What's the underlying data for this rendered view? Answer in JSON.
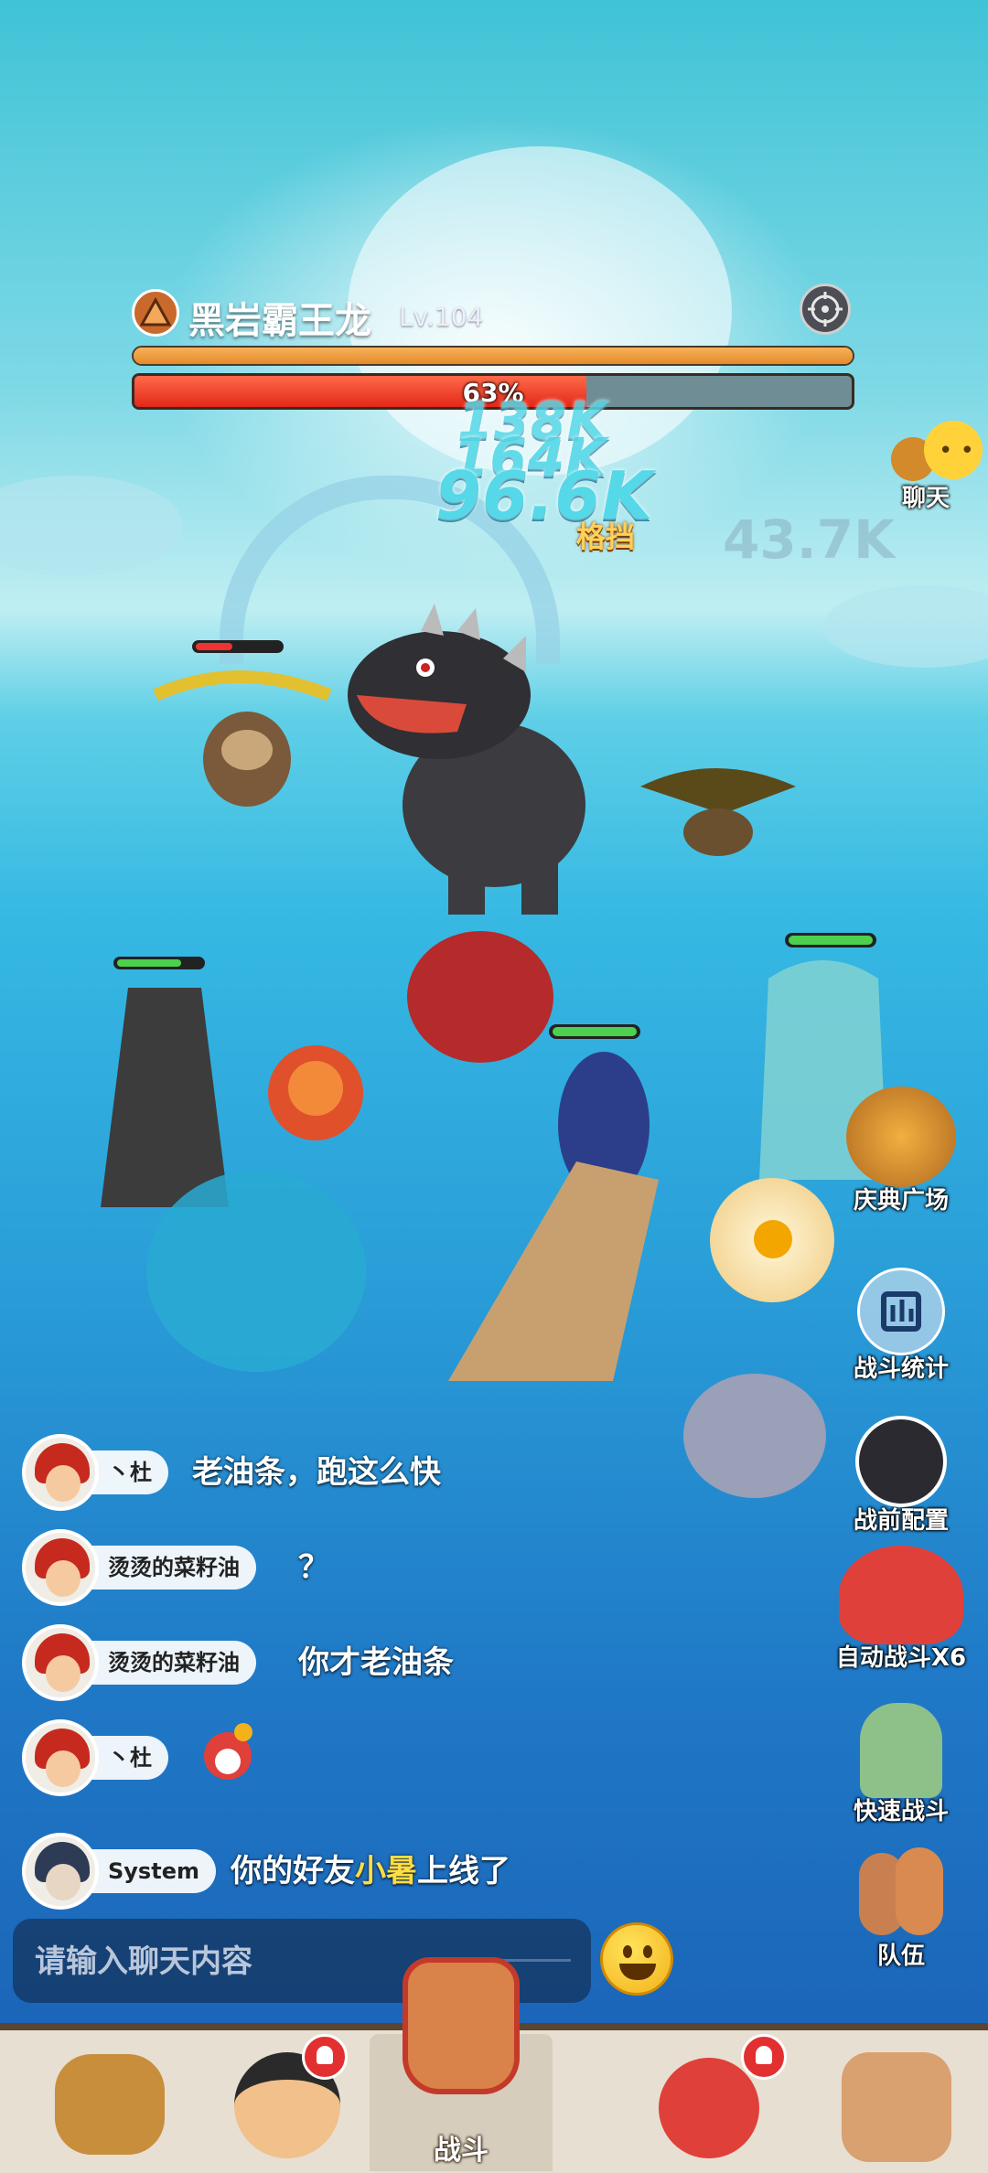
{
  "boss": {
    "name": "黑岩霸王龙",
    "level": "Lv.104",
    "hp_percent_label": "63%",
    "hp_fraction": 0.63,
    "shield_fraction": 1.0
  },
  "damage_numbers": [
    "138K",
    "164K",
    "96.6K",
    "43.7K"
  ],
  "block_label": "格挡",
  "side_buttons": {
    "chat": "聊天",
    "celebration": "庆典广场",
    "battle_stats": "战斗统计",
    "pre_battle": "战前配置",
    "auto_battle": "自动战斗X6",
    "quick_battle": "快速战斗",
    "team": "队伍"
  },
  "chat_messages": [
    {
      "sender": "丶杜",
      "text": "老油条，跑这么快"
    },
    {
      "sender": "烫烫的菜籽油",
      "text": "？"
    },
    {
      "sender": "烫烫的菜籽油",
      "text": "你才老油条"
    },
    {
      "sender": "丶杜",
      "text": ""
    },
    {
      "sender": "System",
      "text_before": "你的好友",
      "highlight": "小暑",
      "text_after": "上线了"
    }
  ],
  "chat_input": {
    "placeholder": "请输入聊天内容"
  },
  "bottom_nav": {
    "battle": "战斗"
  },
  "colors": {
    "hp": "#e32818",
    "shield": "#e58a2a",
    "highlight": "#ffdd44"
  }
}
